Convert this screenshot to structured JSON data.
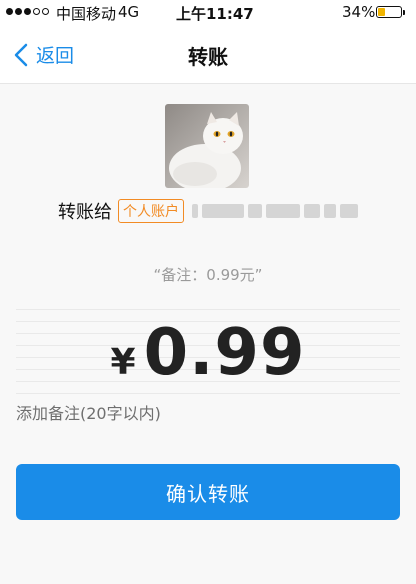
{
  "status_bar": {
    "carrier": "中国移动",
    "network": "4G",
    "time": "上午11:47",
    "battery_percent_label": "34%",
    "battery_level": 0.34,
    "battery_color": "#f0b400",
    "signal_bars_filled": 3,
    "signal_bars_total": 5
  },
  "nav": {
    "back_label": "返回",
    "back_icon": "chevron-left-icon",
    "title": "转账"
  },
  "recipient": {
    "avatar": "white-cat-photo",
    "prefix": "转账给",
    "account_type_badge": "个人账户"
  },
  "transfer": {
    "memo_hint": "“备注：0.99元”",
    "currency_symbol": "¥",
    "amount": "0.99",
    "memo_placeholder": "添加备注(20字以内)",
    "confirm_label": "确认转账"
  },
  "colors": {
    "accent": "#1a8ce8",
    "badge": "#f28b24"
  }
}
